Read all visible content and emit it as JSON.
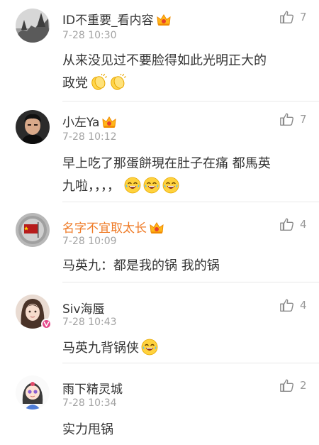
{
  "comments": [
    {
      "name": "ID不重要_看内容",
      "time": "7-28 10:30",
      "likes": "7",
      "text_line1": "从来没见过不要脸得如此光明正大的",
      "text_line2": "政党"
    },
    {
      "name": "小左Ya",
      "time": "7-28 10:12",
      "likes": "7",
      "text_line1": "早上吃了那蛋餅現在肚子在痛 都馬英",
      "text_line2": "九啦，，，，"
    },
    {
      "name": "名字不宜取太长",
      "time": "7-28 10:09",
      "likes": "4",
      "text_line1": "马英九：都是我的锅 我的锅"
    },
    {
      "name": "Siv海蜃",
      "time": "7-28 10:43",
      "likes": "4",
      "text_line1": "马英九背锅侠"
    },
    {
      "name": "雨下精灵城",
      "time": "7-28 10:34",
      "likes": "2",
      "text_line1": "实力甩锅"
    }
  ],
  "colors": {
    "name": "#333333",
    "vip_name": "#ef7a25",
    "time": "#a3a3a3",
    "like": "#999999",
    "divider": "#e8e8e8",
    "vip_badge": "#e5488a"
  },
  "icons": {
    "like": "thumbs-up-icon",
    "crown": "vip-crown-icon",
    "badge": "verified-v-badge-icon",
    "emoji_clap": "clapping-hands-emoji",
    "emoji_laugh": "laughing-tears-emoji"
  }
}
